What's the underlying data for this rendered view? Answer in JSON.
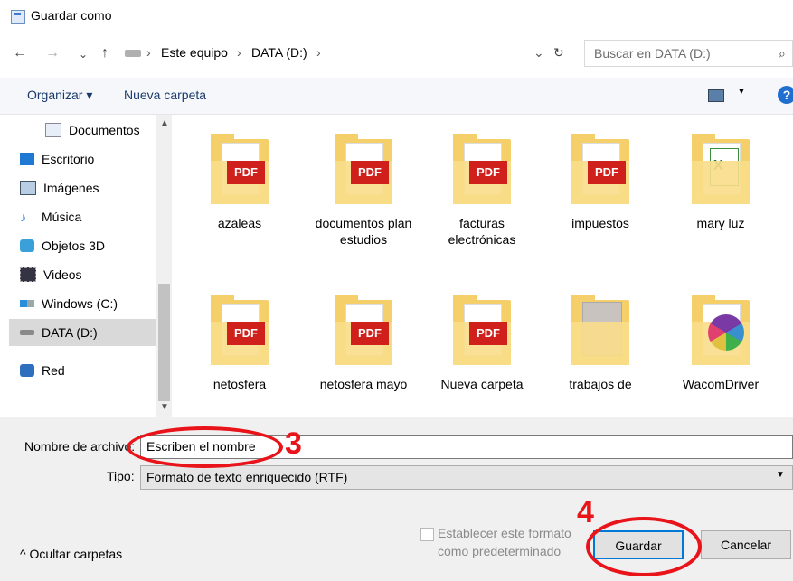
{
  "window": {
    "title": "Guardar como"
  },
  "address": {
    "crumbs": [
      "Este equipo",
      "DATA (D:)"
    ]
  },
  "search": {
    "placeholder": "Buscar en DATA (D:)"
  },
  "toolbar": {
    "organize": "Organizar ▾",
    "new_folder": "Nueva carpeta"
  },
  "sidebar": {
    "items": [
      {
        "label": "Documentos",
        "icon": "documents-icon"
      },
      {
        "label": "Escritorio",
        "icon": "desktop-icon"
      },
      {
        "label": "Imágenes",
        "icon": "pictures-icon"
      },
      {
        "label": "Música",
        "icon": "music-icon"
      },
      {
        "label": "Objetos 3D",
        "icon": "3d-objects-icon"
      },
      {
        "label": "Videos",
        "icon": "videos-icon"
      },
      {
        "label": "Windows (C:)",
        "icon": "drive-c-icon"
      },
      {
        "label": "DATA (D:)",
        "icon": "drive-d-icon",
        "selected": true
      },
      {
        "label": "Red",
        "icon": "network-icon"
      }
    ]
  },
  "files": [
    {
      "name": "azaleas",
      "type": "pdf"
    },
    {
      "name": "documentos plan estudios",
      "type": "pdf"
    },
    {
      "name": "facturas electrónicas",
      "type": "pdf"
    },
    {
      "name": "impuestos",
      "type": "pdf"
    },
    {
      "name": "mary luz",
      "type": "xls"
    },
    {
      "name": "netosfera",
      "type": "pdf"
    },
    {
      "name": "netosfera mayo",
      "type": "pdf"
    },
    {
      "name": "Nueva carpeta",
      "type": "pdf"
    },
    {
      "name": "trabajos de",
      "type": "scan"
    },
    {
      "name": "WacomDriver",
      "type": "wacom"
    }
  ],
  "form": {
    "filename_label": "Nombre de archivo:",
    "filename_value": "Escriben el nombre",
    "type_label": "Tipo:",
    "type_value": "Formato de texto enriquecido (RTF)",
    "checkbox_label_1": "Establecer este formato",
    "checkbox_label_2": "como predeterminado",
    "hide_folders": "^  Ocultar carpetas",
    "save": "Guardar",
    "cancel": "Cancelar"
  },
  "annotations": {
    "step3": "3",
    "step4": "4"
  },
  "colors": {
    "accent": "#0078d7",
    "annotation": "#e8141a",
    "pdf": "#d0201b",
    "folder": "#f4cf6a"
  }
}
